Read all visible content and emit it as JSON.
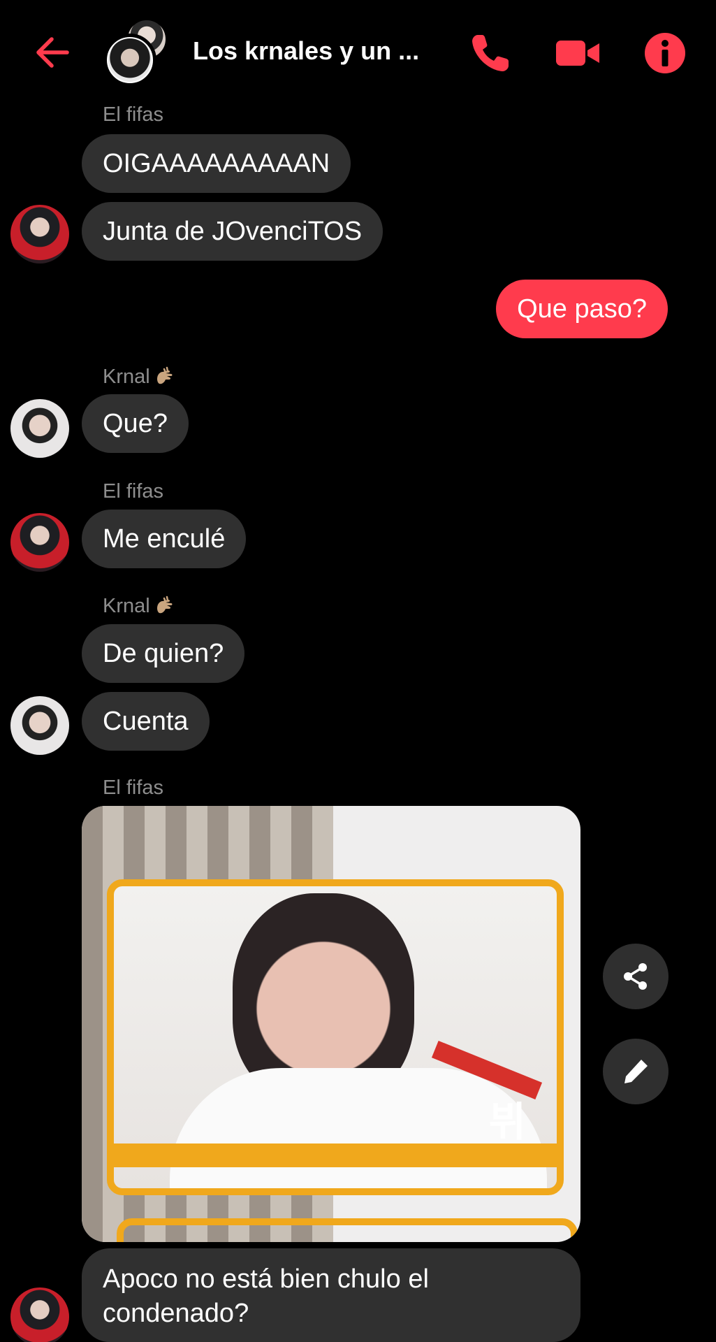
{
  "header": {
    "title": "Los krnales y un ...",
    "back_icon": "arrow-left-icon",
    "call_icon": "phone-icon",
    "video_icon": "video-camera-icon",
    "info_icon": "info-icon",
    "accent_color": "#ff3b4d"
  },
  "messages": [
    {
      "sender": "El fifas",
      "text": "OIGAAAAAAAAAN"
    },
    {
      "text": "Junta de JOvenciTOS"
    },
    {
      "mine": true,
      "text": "Que paso?"
    },
    {
      "sender": "Krnal",
      "text": "Que?"
    },
    {
      "sender": "El fifas",
      "text": "Me enculé"
    },
    {
      "sender": "Krnal",
      "text": "De quien?"
    },
    {
      "text": "Cuenta"
    },
    {
      "sender": "El fifas",
      "image_caption": "뷔"
    },
    {
      "text": "Apoco no está bien chulo el condenado?"
    }
  ],
  "actions": {
    "share_icon": "share-icon",
    "edit_icon": "pencil-icon"
  }
}
